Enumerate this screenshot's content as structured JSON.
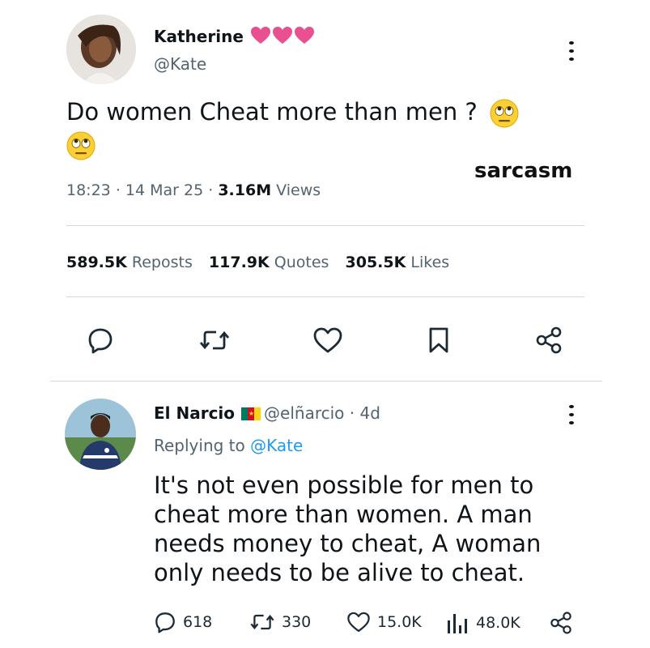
{
  "post": {
    "author_name": "Katherine",
    "author_handle": "@Kate",
    "text_line1": "Do women Cheat more than men ?",
    "overlay_label": "sarcasm",
    "meta": {
      "time": "18:23",
      "date": "14 Mar 25",
      "views_count": "3.16M",
      "views_label": "Views"
    },
    "stats": {
      "reposts_count": "589.5K",
      "reposts_label": "Reposts",
      "quotes_count": "117.9K",
      "quotes_label": "Quotes",
      "likes_count": "305.5K",
      "likes_label": "Likes"
    },
    "actions": [
      "reply-icon",
      "repost-icon",
      "like-icon",
      "bookmark-icon",
      "share-icon"
    ]
  },
  "reply": {
    "author_name": "El Narcio",
    "author_handle": "@elñarcio",
    "time_ago": "4d",
    "replying_to_label": "Replying to",
    "replying_to_handle": "@Kate",
    "text_lines": [
      "It's not even possible for men to",
      "cheat more than women. A man",
      "needs money to cheat, A woman",
      "only needs to be alive to cheat."
    ],
    "metrics": {
      "replies": "618",
      "reposts": "330",
      "likes": "15.0K",
      "views": "48.0K"
    }
  },
  "colors": {
    "text": "#0f1419",
    "muted": "#536471",
    "link": "#1d9bf0",
    "heart_pink": "#e8508f",
    "divider": "#d6d9dc"
  }
}
